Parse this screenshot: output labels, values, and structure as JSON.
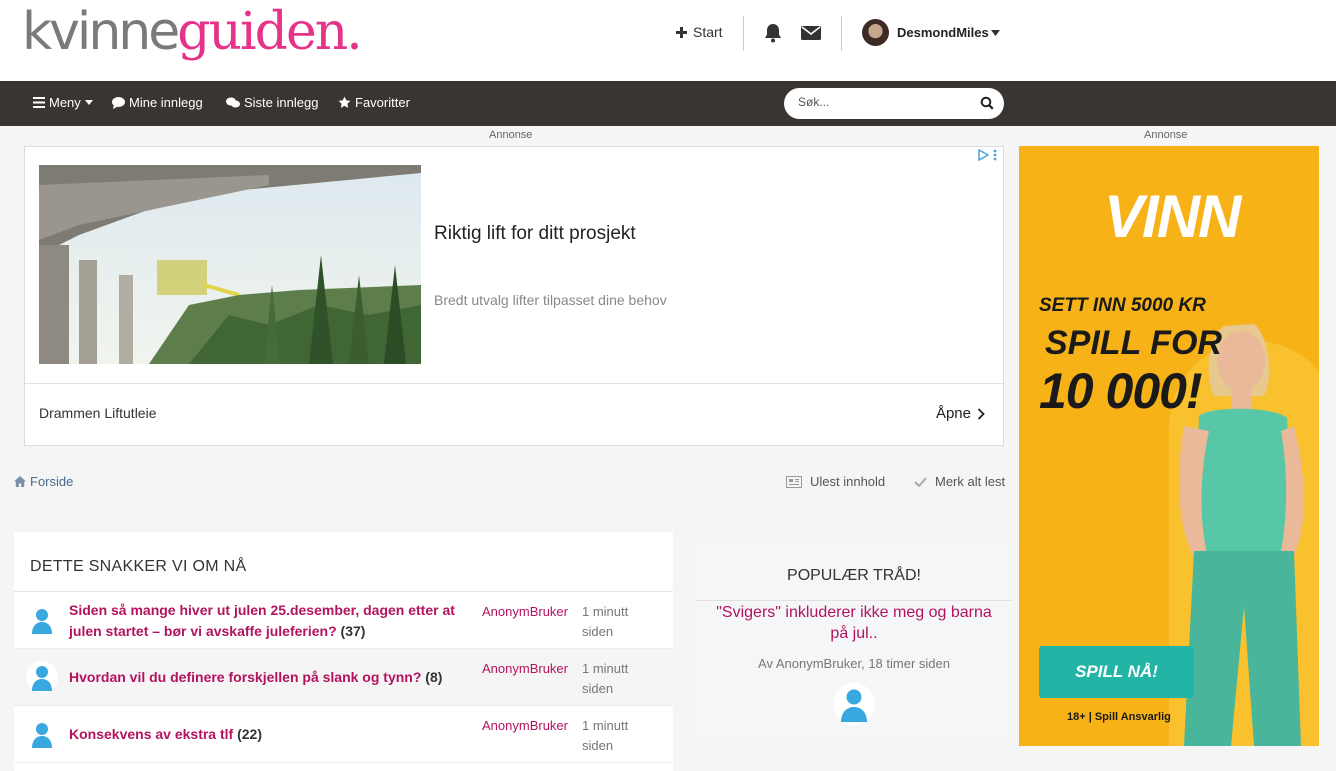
{
  "header": {
    "logo_part1": "kvinne",
    "logo_part2": "guiden.",
    "start_label": "Start",
    "username": "DesmondMiles"
  },
  "nav": {
    "menu_label": "Meny",
    "my_posts_label": "Mine innlegg",
    "latest_posts_label": "Siste innlegg",
    "favorites_label": "Favoritter",
    "search_placeholder": "Søk..."
  },
  "ads": {
    "label_left": "Annonse",
    "label_right": "Annonse",
    "left": {
      "title": "Riktig lift for ditt prosjekt",
      "description": "Bredt utvalg lifter tilpasset dine behov",
      "advertiser": "Drammen Liftutleie",
      "open_label": "Åpne"
    },
    "right": {
      "brand": "VINN",
      "line1": "SETT INN 5000 KR",
      "line2": "SPILL FOR",
      "line3": "10 000!",
      "cta": "SPILL NÅ!",
      "disclaimer": "18+ | Spill Ansvarlig"
    }
  },
  "breadcrumb": {
    "home_label": "Forside",
    "unread_label": "Ulest innhold",
    "mark_read_label": "Merk alt lest"
  },
  "trending": {
    "title": "DETTE SNAKKER VI OM NÅ",
    "rows": [
      {
        "topic": "Siden så mange hiver ut julen 25.desember, dagen etter at julen startet – bør vi avskaffe juleferien?",
        "count": "(37)",
        "author": "AnonymBruker",
        "time": "1 minutt siden"
      },
      {
        "topic": "Hvordan vil du definere forskjellen på slank og tynn?",
        "count": "(8)",
        "author": "AnonymBruker",
        "time": "1 minutt siden"
      },
      {
        "topic": "Konsekvens av ekstra tlf",
        "count": "(22)",
        "author": "AnonymBruker",
        "time": "1 minutt siden"
      }
    ]
  },
  "popular": {
    "title": "POPULÆR TRÅD!",
    "thread": "\"Svigers\" inkluderer ikke meg og barna på jul..",
    "byline": "Av AnonymBruker, 18 timer siden"
  },
  "colors": {
    "accent": "#b3135e",
    "navbar": "#3b3531",
    "logo_pink": "#e6338a",
    "ad_yellow": "#f7b217",
    "cta_teal": "#22b5a6",
    "avatar_blue": "#3aa8e0"
  }
}
